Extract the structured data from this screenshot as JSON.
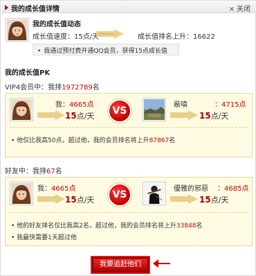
{
  "window": {
    "title": "我的成长值详情",
    "close_label": "关闭",
    "close_glyph": "×"
  },
  "dynamic": {
    "title": "我的成长值动态",
    "speed": "成长值速度：15点/天",
    "rank": "成长值排名上升：16622",
    "tip_bullet": "•",
    "tip": "我通过预付费开通QQ会员，获得15点成长值"
  },
  "pk": {
    "title": "我的成长值PK",
    "vip_section": {
      "prefix": "VIP4会员中：我排",
      "rank": "1972789",
      "suffix": "名",
      "me": {
        "label": "我：",
        "value": "4665点",
        "rate": "15",
        "rate_unit": "点/天"
      },
      "vs": "VS",
      "opponent": {
        "name": "蔽嗔",
        "value": "：4715点",
        "rate": "15",
        "rate_unit": "点/天"
      },
      "info": {
        "text": "• 他仅比我高50点，超过他，我的会员排名将上升",
        "num": "87867",
        "suffix": "名"
      }
    },
    "friend_section": {
      "prefix": "好友中：我排",
      "rank": "67",
      "suffix": "名",
      "me": {
        "label": "我：",
        "value": "4665点",
        "rate": "15",
        "rate_unit": "点/天"
      },
      "vs": "VS",
      "opponent": {
        "name": "優雅的邪惡",
        "value": "：4685点",
        "rate": "15",
        "rate_unit": "点/天"
      },
      "info1": {
        "text": "• 他的好友排名仅比我高2名，超过他，我的会员排名将上升",
        "num": "33848",
        "suffix": "名"
      },
      "info2": "• 我最快需要1天超过他"
    }
  },
  "action": {
    "chase_label": "我要追赶他们"
  },
  "colors": {
    "accent": "#c40000",
    "panel_bg": "#fffbe3",
    "panel_border": "#ecd79c"
  },
  "icons": [
    "arrow-right-icon",
    "close-icon",
    "user-avatar-icon",
    "vs-badge-icon",
    "progress-arrow-icon",
    "red-pointer-arrow-icon"
  ]
}
